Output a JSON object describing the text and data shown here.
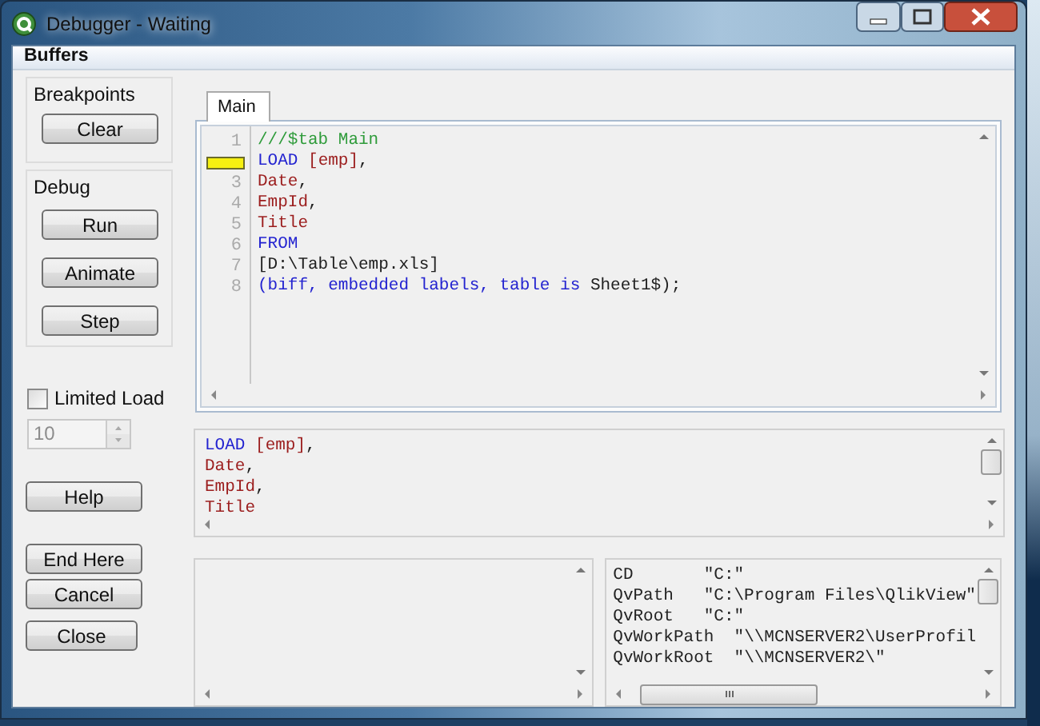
{
  "window": {
    "title": "Debugger - Waiting"
  },
  "menu": [
    "Buffers"
  ],
  "breakpoints": {
    "label": "Breakpoints",
    "buttons": [
      "Clear"
    ]
  },
  "debug": {
    "label": "Debug",
    "buttons": [
      "Run",
      "Animate",
      "Step"
    ]
  },
  "limited_load": {
    "label": "Limited Load",
    "checked": false,
    "value": "10",
    "disabled": true
  },
  "help_button": "Help",
  "exit_buttons": [
    "End Here",
    "Cancel",
    "Close"
  ],
  "tabs": [
    {
      "label": "Main",
      "selected": true
    }
  ],
  "script_lines": [
    {
      "number": "1",
      "breakpoint": false,
      "tokens": [
        {
          "kind": "comment",
          "text": "///$tab Main"
        }
      ]
    },
    {
      "breakpoint": true,
      "tokens": [
        {
          "kind": "keyword",
          "text": "LOAD"
        },
        {
          "kind": "field",
          "text": " [emp]"
        },
        {
          "kind": "plain",
          "text": ","
        }
      ]
    },
    {
      "number": "3",
      "breakpoint": false,
      "tokens": [
        {
          "kind": "field",
          "text": "Date"
        },
        {
          "kind": "plain",
          "text": ","
        }
      ]
    },
    {
      "number": "4",
      "breakpoint": false,
      "tokens": [
        {
          "kind": "field",
          "text": "EmpId"
        },
        {
          "kind": "plain",
          "text": ","
        }
      ]
    },
    {
      "number": "5",
      "breakpoint": false,
      "tokens": [
        {
          "kind": "field",
          "text": "Title"
        }
      ]
    },
    {
      "number": "6",
      "breakpoint": false,
      "tokens": [
        {
          "kind": "keyword",
          "text": "FROM"
        }
      ]
    },
    {
      "number": "7",
      "breakpoint": false,
      "tokens": [
        {
          "kind": "plain",
          "text": "[D:\\Table\\emp.xls]"
        }
      ]
    },
    {
      "number": "8",
      "breakpoint": false,
      "tokens": [
        {
          "kind": "keyword",
          "text": "(biff, embedded labels, table is"
        },
        {
          "kind": "plain",
          "text": " Sheet1$);"
        }
      ]
    }
  ],
  "statement_lines": [
    {
      "tokens": [
        {
          "kind": "keyword",
          "text": "LOAD"
        },
        {
          "kind": "field",
          "text": " [emp]"
        },
        {
          "kind": "plain",
          "text": ","
        }
      ]
    },
    {
      "tokens": [
        {
          "kind": "field",
          "text": "Date"
        },
        {
          "kind": "plain",
          "text": ","
        }
      ]
    },
    {
      "tokens": [
        {
          "kind": "field",
          "text": "EmpId"
        },
        {
          "kind": "plain",
          "text": ","
        }
      ]
    },
    {
      "tokens": [
        {
          "kind": "field",
          "text": "Title"
        }
      ]
    }
  ],
  "variables": [
    {
      "name": "CD",
      "value": "\"C:\""
    },
    {
      "name": "QvPath",
      "value": "\"C:\\Program Files\\QlikView\""
    },
    {
      "name": "QvRoot",
      "value": "\"C:\""
    },
    {
      "name": "QvWorkPath",
      "value": "\"\\\\MCNSERVER2\\UserProfil"
    },
    {
      "name": "QvWorkRoot",
      "value": "\"\\\\MCNSERVER2\\\""
    }
  ]
}
